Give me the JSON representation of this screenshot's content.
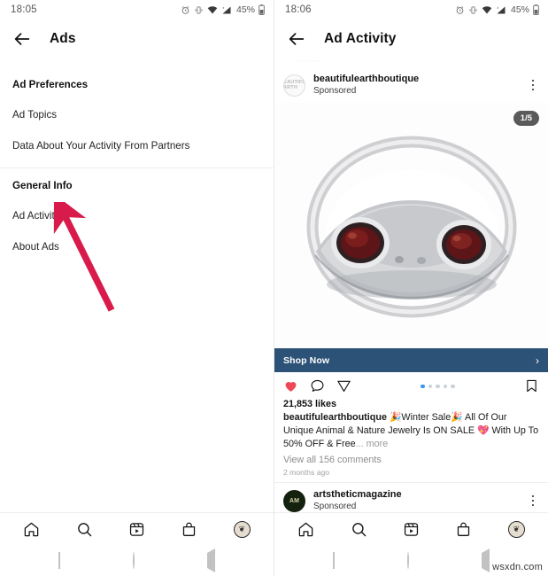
{
  "left": {
    "status": {
      "time": "18:05",
      "battery": "45%",
      "icons": [
        "alarm-icon",
        "vibrate-icon",
        "wifi-icon",
        "signal-icon",
        "battery-icon"
      ]
    },
    "header": {
      "back": "back-arrow",
      "title": "Ads"
    },
    "sections": [
      {
        "heading": "Ad Preferences",
        "items": [
          "Ad Topics",
          "Data About Your Activity From Partners"
        ]
      },
      {
        "heading": "General Info",
        "items": [
          "Ad Activity",
          "About Ads"
        ]
      }
    ],
    "annotation": {
      "type": "arrow",
      "color": "#d81b4a",
      "points_to": "Ad Activity"
    }
  },
  "right": {
    "status": {
      "time": "18:06",
      "battery": "45%"
    },
    "header": {
      "back": "back-arrow",
      "title": "Ad Activity"
    },
    "posts": [
      {
        "username": "beautifulearthboutique",
        "sublabel": "Sponsored",
        "avatar_mark": "BEAUTIFUL EARTH",
        "carousel_count": "1/5",
        "carousel_dots": 5,
        "carousel_active": 1,
        "cta_label": "Shop Now",
        "cta_chevron": "›",
        "cta_color": "#2d5277",
        "likes": "21,853 likes",
        "caption_user": "beautifulearthboutique",
        "caption_text": " 🎉Winter Sale🎉 All Of Our Unique Animal & Nature Jewelry Is ON SALE 💖 With Up To 50% OFF & Free",
        "caption_more": "... more",
        "comments": "View all 156 comments",
        "timestamp": "2 months ago",
        "liked": true,
        "like_color": "#ed4956"
      },
      {
        "username": "artstheticmagazine",
        "sublabel": "Sponsored",
        "avatar_mark": "AM"
      }
    ]
  },
  "tabbar": {
    "items": [
      "home-icon",
      "search-icon",
      "reels-icon",
      "shop-icon",
      "profile-avatar"
    ],
    "profile_glyph": "❦"
  },
  "sysnav": {
    "items": [
      "recents-button",
      "home-button",
      "back-button"
    ]
  },
  "watermark": "wsxdn.com"
}
